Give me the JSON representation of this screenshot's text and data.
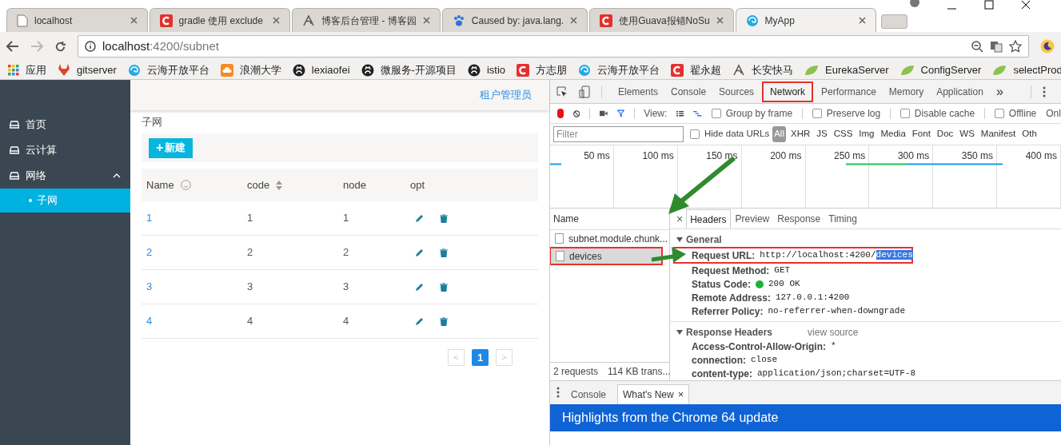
{
  "browser": {
    "tabs": [
      {
        "title": "localhost",
        "kind": "page",
        "selected": false
      },
      {
        "title": "gradle 使用 exclude",
        "kind": "csdn",
        "selected": false
      },
      {
        "title": "博客后台管理 - 博客园",
        "kind": "pen",
        "selected": false
      },
      {
        "title": "Caused by: java.lang.",
        "kind": "paw",
        "selected": false
      },
      {
        "title": "使用Guava报错NoSu",
        "kind": "csdn",
        "selected": false
      },
      {
        "title": "MyApp",
        "kind": "swirl",
        "selected": true
      }
    ],
    "address": {
      "host": "localhost",
      "path": ":4200/subnet"
    },
    "bookmarks": [
      {
        "label": "应用",
        "kind": "apps"
      },
      {
        "label": "gitserver",
        "kind": "gitlab"
      },
      {
        "label": "云海开放平台",
        "kind": "swirl"
      },
      {
        "label": "浪潮大学",
        "kind": "cloud"
      },
      {
        "label": "lexiaofei",
        "kind": "github"
      },
      {
        "label": "微服务-开源项目",
        "kind": "github"
      },
      {
        "label": "istio",
        "kind": "github"
      },
      {
        "label": "方志朋",
        "kind": "csdn"
      },
      {
        "label": "云海开放平台",
        "kind": "swirl"
      },
      {
        "label": "翟永超",
        "kind": "csdn"
      },
      {
        "label": "长安快马",
        "kind": "pen"
      },
      {
        "label": "EurekaServer",
        "kind": "leaf"
      },
      {
        "label": "ConfigServer",
        "kind": "leaf"
      },
      {
        "label": "selectProd",
        "kind": "leaf"
      }
    ]
  },
  "app": {
    "user": "租户管理员",
    "sidebar": [
      {
        "label": "首页"
      },
      {
        "label": "云计算"
      },
      {
        "label": "网络",
        "expanded": true,
        "children": [
          {
            "label": "子网",
            "selected": true
          }
        ]
      }
    ],
    "breadcrumb": "子网",
    "new_button": {
      "plus": "+",
      "label": "新建"
    },
    "columns": [
      {
        "label": "Name",
        "kind": "smiley"
      },
      {
        "label": "code",
        "kind": "sort"
      },
      {
        "label": "node",
        "kind": "plain"
      },
      {
        "label": "opt",
        "kind": "plain"
      }
    ],
    "rows": [
      {
        "name": "1",
        "code": "1",
        "node": "1"
      },
      {
        "name": "2",
        "code": "2",
        "node": "2"
      },
      {
        "name": "3",
        "code": "3",
        "node": "3"
      },
      {
        "name": "4",
        "code": "4",
        "node": "4"
      }
    ],
    "pagination": {
      "prev": "<",
      "pages": [
        {
          "label": "1",
          "selected": true
        }
      ],
      "next": ">"
    }
  },
  "devtools": {
    "tabs": [
      {
        "label": "Elements",
        "selected": false
      },
      {
        "label": "Console",
        "selected": false
      },
      {
        "label": "Sources",
        "selected": false
      },
      {
        "label": "Network",
        "selected": true
      },
      {
        "label": "Performance",
        "selected": false
      },
      {
        "label": "Memory",
        "selected": false
      },
      {
        "label": "Application",
        "selected": false
      }
    ],
    "more": "»",
    "toolbar": {
      "view_label": "View:",
      "checks": [
        {
          "label": "Group by frame",
          "checked": false
        },
        {
          "label": "Preserve log",
          "checked": false
        },
        {
          "label": "Disable cache",
          "checked": false
        },
        {
          "label": "Offline",
          "checked": false
        }
      ],
      "online": "Onl"
    },
    "filter": {
      "placeholder": "Filter",
      "hide_data": {
        "label": "Hide data URLs",
        "checked": false
      },
      "types": [
        {
          "label": "All",
          "selected": true
        },
        {
          "label": "XHR",
          "selected": false
        },
        {
          "label": "JS",
          "selected": false
        },
        {
          "label": "CSS",
          "selected": false
        },
        {
          "label": "Img",
          "selected": false
        },
        {
          "label": "Media",
          "selected": false
        },
        {
          "label": "Font",
          "selected": false
        },
        {
          "label": "Doc",
          "selected": false
        },
        {
          "label": "WS",
          "selected": false
        },
        {
          "label": "Manifest",
          "selected": false
        },
        {
          "label": "Oth",
          "selected": false
        }
      ]
    },
    "ticks": [
      "50 ms",
      "100 ms",
      "150 ms",
      "200 ms",
      "250 ms",
      "300 ms",
      "350 ms",
      "400 ms"
    ],
    "name_header": "Name",
    "requests": [
      {
        "name": "subnet.module.chunk...",
        "selected": false
      },
      {
        "name": "devices",
        "selected": true
      }
    ],
    "summary": [
      "2 requests",
      "114 KB trans..."
    ],
    "close": "×",
    "detail_tabs": [
      {
        "label": "Headers",
        "selected": true
      },
      {
        "label": "Preview",
        "selected": false
      },
      {
        "label": "Response",
        "selected": false
      },
      {
        "label": "Timing",
        "selected": false
      }
    ],
    "general": {
      "title": "General",
      "expanded": true,
      "rows": [
        {
          "name": "Request URL:",
          "value": "http://localhost:4200/",
          "selected_value": "devices"
        },
        {
          "name": "Request Method:",
          "value": "GET"
        },
        {
          "name": "Status Code:",
          "value": "200 OK",
          "status_ok": true
        },
        {
          "name": "Remote Address:",
          "value": "127.0.0.1:4200"
        },
        {
          "name": "Referrer Policy:",
          "value": "no-referrer-when-downgrade"
        }
      ]
    },
    "response": {
      "title": "Response Headers",
      "expanded": true,
      "link": "view source",
      "rows": [
        {
          "name": "Access-Control-Allow-Origin:",
          "value": "*"
        },
        {
          "name": "connection:",
          "value": "close"
        },
        {
          "name": "content-type:",
          "value": "application/json;charset=UTF-8"
        }
      ]
    },
    "drawer": {
      "tabs": [
        {
          "label": "Console",
          "selected": false
        },
        {
          "label": "What's New",
          "selected": true
        }
      ],
      "close": "×",
      "banner": "Highlights from the Chrome 64 update"
    }
  }
}
